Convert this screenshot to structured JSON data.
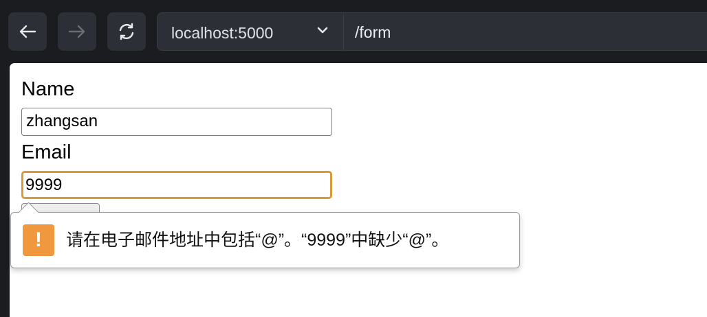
{
  "toolbar": {
    "back_icon": "arrow-left-icon",
    "forward_icon": "arrow-right-icon",
    "reload_icon": "reload-icon",
    "host": "localhost:5000",
    "path": "/form"
  },
  "form": {
    "name_label": "Name",
    "name_value": "zhangsan",
    "email_label": "Email",
    "email_value": "9999"
  },
  "tooltip": {
    "icon": "warning-icon",
    "icon_glyph": "!",
    "message": "请在电子邮件地址中包括“@”。“9999”中缺少“@”。"
  },
  "colors": {
    "focus_border": "#d79a36",
    "warning": "#f0983d"
  }
}
